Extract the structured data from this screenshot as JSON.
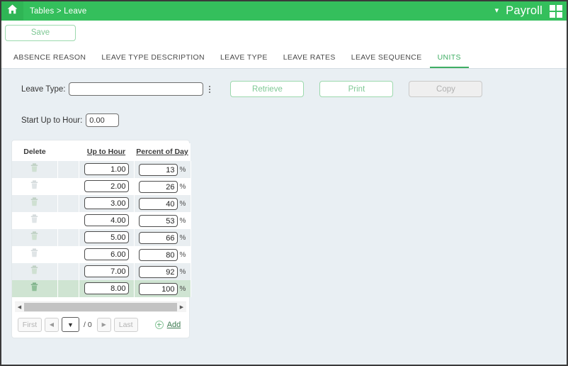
{
  "window": {
    "app_name": "Payroll",
    "breadcrumb": "Tables > Leave",
    "home_icon": "home-icon",
    "chevron_icon": "chevron-down-icon",
    "apps_icon": "grid-apps-icon",
    "accent_green": "#34bf5c",
    "page_background": "#e9eff3"
  },
  "toolbar": {
    "save_label": "Save"
  },
  "tabs": [
    {
      "label": "ABSENCE REASON",
      "active": false
    },
    {
      "label": "LEAVE TYPE DESCRIPTION",
      "active": false
    },
    {
      "label": "LEAVE TYPE",
      "active": false
    },
    {
      "label": "LEAVE RATES",
      "active": false
    },
    {
      "label": "LEAVE SEQUENCE",
      "active": false
    },
    {
      "label": "UNITS",
      "active": true
    }
  ],
  "form": {
    "leave_type_label": "Leave Type:",
    "leave_type_value": "",
    "leave_type_placeholder": "",
    "ellipsis_icon": "vertical-ellipsis-icon",
    "retrieve_label": "Retrieve",
    "print_label": "Print",
    "copy_label": "Copy",
    "start_up_to_hour_label": "Start Up to Hour:",
    "start_up_to_hour_value": "0.00"
  },
  "grid": {
    "columns": [
      {
        "label": "Delete",
        "sortable": false
      },
      {
        "label": "",
        "sortable": false
      },
      {
        "label": "Up to Hour",
        "sortable": true
      },
      {
        "label": "Percent of Day",
        "sortable": true
      }
    ],
    "percent_suffix": "%",
    "delete_icon": "trash-icon",
    "rows": [
      {
        "up_to_hour": "1.00",
        "percent_of_day": "13",
        "selected": false
      },
      {
        "up_to_hour": "2.00",
        "percent_of_day": "26",
        "selected": false
      },
      {
        "up_to_hour": "3.00",
        "percent_of_day": "40",
        "selected": false
      },
      {
        "up_to_hour": "4.00",
        "percent_of_day": "53",
        "selected": false
      },
      {
        "up_to_hour": "5.00",
        "percent_of_day": "66",
        "selected": false
      },
      {
        "up_to_hour": "6.00",
        "percent_of_day": "80",
        "selected": false
      },
      {
        "up_to_hour": "7.00",
        "percent_of_day": "92",
        "selected": false
      },
      {
        "up_to_hour": "8.00",
        "percent_of_day": "100",
        "selected": true
      }
    ]
  },
  "pager": {
    "first_label": "First",
    "prev_icon": "prev-arrow-icon",
    "page_select_value": "",
    "page_select_icon": "chevron-down-icon",
    "total_pages": "/ 0",
    "next_icon": "next-arrow-icon",
    "last_label": "Last",
    "add_label": "Add",
    "add_icon": "plus-circle-icon"
  },
  "scrollbar": {
    "left_icon": "scroll-left-arrow-icon",
    "right_icon": "scroll-right-arrow-icon"
  }
}
